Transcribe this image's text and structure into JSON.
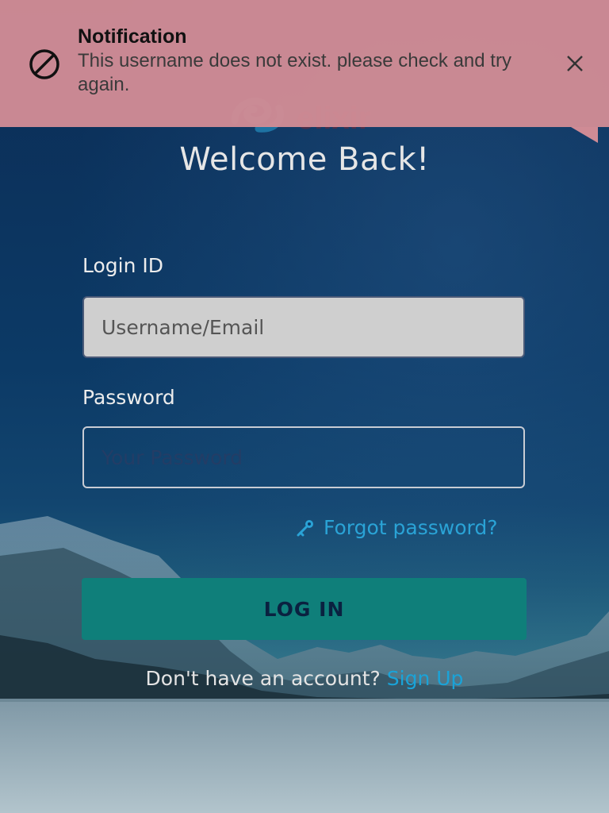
{
  "notification": {
    "title": "Notification",
    "message": "This username does not exist. please check and try again.",
    "icon": "block-icon",
    "close_icon": "close-icon",
    "background_color": "#cf8b95"
  },
  "brand": {
    "logo_text": "elixir",
    "accent_color": "#2aa3d6"
  },
  "page": {
    "heading": "Welcome Back!"
  },
  "form": {
    "login_label": "Login ID",
    "login_placeholder": "Username/Email",
    "password_label": "Password",
    "password_placeholder": "Your Password",
    "forgot_label": "Forgot password?",
    "forgot_icon": "key-icon",
    "submit_label": "LOG IN",
    "submit_color": "#0f7f7a",
    "no_account_text": "Don't have an account?",
    "signup_label": "Sign Up"
  }
}
